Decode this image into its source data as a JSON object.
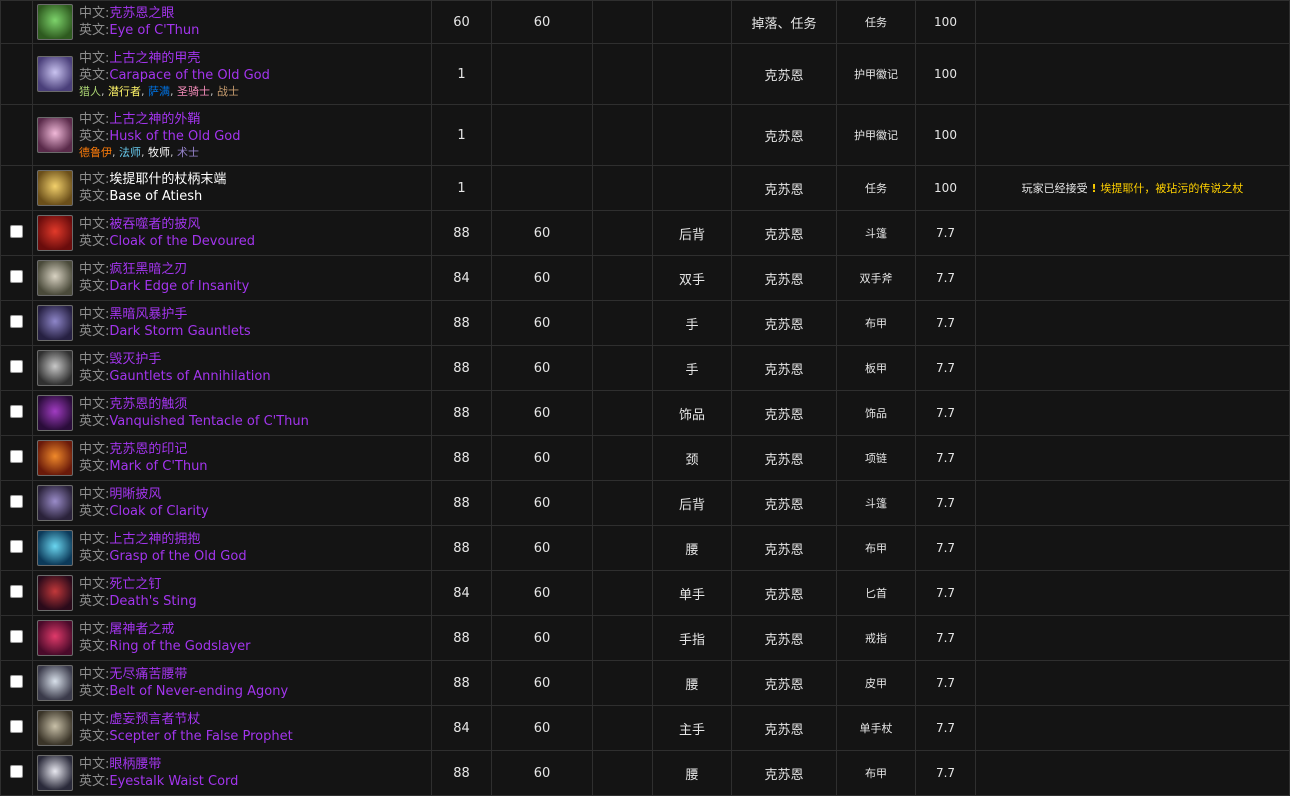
{
  "labels": {
    "cn": "中文:",
    "en": "英文:",
    "note_prefix": "玩家已经接受",
    "note_link": "埃提耶什，被玷污的传说之杖"
  },
  "rows": [
    {
      "check": false,
      "icon": "eye-of-cthun-icon",
      "icon_colors": [
        "#7dd36b",
        "#2e5a1f"
      ],
      "cn": "克苏恩之眼",
      "en": "Eye of C'Thun",
      "quality": "epic",
      "level": "60",
      "req": "60",
      "slot": "",
      "source": "掉落、任务",
      "type": "任务",
      "phase": "100",
      "classes": [],
      "note": false,
      "height": 43
    },
    {
      "check": false,
      "icon": "carapace-icon",
      "icon_colors": [
        "#c9c3f0",
        "#4a3f7a"
      ],
      "cn": "上古之神的甲壳",
      "en": "Carapace of the Old God",
      "quality": "epic",
      "level": "1",
      "req": "",
      "slot": "",
      "source": "克苏恩",
      "type": "护甲徽记",
      "phase": "100",
      "classes": [
        {
          "name": "猎人",
          "color": "#abd473"
        },
        {
          "name": "潜行者",
          "color": "#fff569"
        },
        {
          "name": "萨满",
          "color": "#0070de"
        },
        {
          "name": "圣骑士",
          "color": "#f58cba"
        },
        {
          "name": "战士",
          "color": "#c79c6e"
        }
      ],
      "note": false,
      "height": 61
    },
    {
      "check": false,
      "icon": "husk-icon",
      "icon_colors": [
        "#f0b8d8",
        "#5a2a4a"
      ],
      "cn": "上古之神的外鞘",
      "en": "Husk of the Old God",
      "quality": "epic",
      "level": "1",
      "req": "",
      "slot": "",
      "source": "克苏恩",
      "type": "护甲徽记",
      "phase": "100",
      "classes": [
        {
          "name": "德鲁伊",
          "color": "#ff7d0a"
        },
        {
          "name": "法师",
          "color": "#69ccf0"
        },
        {
          "name": "牧师",
          "color": "#ffffff"
        },
        {
          "name": "术士",
          "color": "#9482c9"
        }
      ],
      "note": false,
      "height": 61
    },
    {
      "check": false,
      "icon": "base-of-atiesh-icon",
      "icon_colors": [
        "#f2d06b",
        "#6b4f1a"
      ],
      "cn": "埃提耶什的杖柄末端",
      "en": "Base of Atiesh",
      "quality": "white",
      "level": "1",
      "req": "",
      "slot": "",
      "source": "克苏恩",
      "type": "任务",
      "phase": "100",
      "classes": [],
      "note": true,
      "height": 45
    },
    {
      "check": true,
      "icon": "cloak-devoured-icon",
      "icon_colors": [
        "#e23a2a",
        "#6a0c0c"
      ],
      "cn": "被吞噬者的披风",
      "en": "Cloak of the Devoured",
      "quality": "epic",
      "level": "88",
      "req": "60",
      "slot": "后背",
      "source": "克苏恩",
      "type": "斗篷",
      "phase": "7.7",
      "classes": [],
      "note": false,
      "height": 45
    },
    {
      "check": true,
      "icon": "dark-edge-icon",
      "icon_colors": [
        "#d8d2c2",
        "#4a4a3a"
      ],
      "cn": "疯狂黑暗之刃",
      "en": "Dark Edge of Insanity",
      "quality": "epic",
      "level": "84",
      "req": "60",
      "slot": "双手",
      "source": "克苏恩",
      "type": "双手斧",
      "phase": "7.7",
      "classes": [],
      "note": false,
      "height": 45
    },
    {
      "check": true,
      "icon": "dark-storm-gauntlets-icon",
      "icon_colors": [
        "#8e86c9",
        "#262042"
      ],
      "cn": "黑暗风暴护手",
      "en": "Dark Storm Gauntlets",
      "quality": "epic",
      "level": "88",
      "req": "60",
      "slot": "手",
      "source": "克苏恩",
      "type": "布甲",
      "phase": "7.7",
      "classes": [],
      "note": false,
      "height": 45
    },
    {
      "check": true,
      "icon": "gauntlets-annihilation-icon",
      "icon_colors": [
        "#c8c8c8",
        "#303030"
      ],
      "cn": "毁灭护手",
      "en": "Gauntlets of Annihilation",
      "quality": "epic",
      "level": "88",
      "req": "60",
      "slot": "手",
      "source": "克苏恩",
      "type": "板甲",
      "phase": "7.7",
      "classes": [],
      "note": false,
      "height": 45
    },
    {
      "check": true,
      "icon": "tentacle-icon",
      "icon_colors": [
        "#a13cc2",
        "#2a0c3a"
      ],
      "cn": "克苏恩的触须",
      "en": "Vanquished Tentacle of C'Thun",
      "quality": "epic",
      "level": "88",
      "req": "60",
      "slot": "饰品",
      "source": "克苏恩",
      "type": "饰品",
      "phase": "7.7",
      "classes": [],
      "note": false,
      "height": 45
    },
    {
      "check": true,
      "icon": "mark-of-cthun-icon",
      "icon_colors": [
        "#f0892a",
        "#6a1a0a"
      ],
      "cn": "克苏恩的印记",
      "en": "Mark of C'Thun",
      "quality": "epic",
      "level": "88",
      "req": "60",
      "slot": "颈",
      "source": "克苏恩",
      "type": "项链",
      "phase": "7.7",
      "classes": [],
      "note": false,
      "height": 45
    },
    {
      "check": true,
      "icon": "cloak-clarity-icon",
      "icon_colors": [
        "#9a8cc9",
        "#2a223a"
      ],
      "cn": "明晰披风",
      "en": "Cloak of Clarity",
      "quality": "epic",
      "level": "88",
      "req": "60",
      "slot": "后背",
      "source": "克苏恩",
      "type": "斗篷",
      "phase": "7.7",
      "classes": [],
      "note": false,
      "height": 45
    },
    {
      "check": true,
      "icon": "grasp-old-god-icon",
      "icon_colors": [
        "#6ad6f0",
        "#0c3a5a"
      ],
      "cn": "上古之神的拥抱",
      "en": "Grasp of the Old God",
      "quality": "epic",
      "level": "88",
      "req": "60",
      "slot": "腰",
      "source": "克苏恩",
      "type": "布甲",
      "phase": "7.7",
      "classes": [],
      "note": false,
      "height": 45
    },
    {
      "check": true,
      "icon": "deaths-sting-icon",
      "icon_colors": [
        "#c2383a",
        "#2a0a1a"
      ],
      "cn": "死亡之钉",
      "en": "Death's Sting",
      "quality": "epic",
      "level": "84",
      "req": "60",
      "slot": "单手",
      "source": "克苏恩",
      "type": "匕首",
      "phase": "7.7",
      "classes": [],
      "note": false,
      "height": 45
    },
    {
      "check": true,
      "icon": "ring-godslayer-icon",
      "icon_colors": [
        "#e03a6a",
        "#4a0a2a"
      ],
      "cn": "屠神者之戒",
      "en": "Ring of the Godslayer",
      "quality": "epic",
      "level": "88",
      "req": "60",
      "slot": "手指",
      "source": "克苏恩",
      "type": "戒指",
      "phase": "7.7",
      "classes": [],
      "note": false,
      "height": 45
    },
    {
      "check": true,
      "icon": "belt-agony-icon",
      "icon_colors": [
        "#d8e0ea",
        "#3a3a4a"
      ],
      "cn": "无尽痛苦腰带",
      "en": "Belt of Never-ending Agony",
      "quality": "epic",
      "level": "88",
      "req": "60",
      "slot": "腰",
      "source": "克苏恩",
      "type": "皮甲",
      "phase": "7.7",
      "classes": [],
      "note": false,
      "height": 45
    },
    {
      "check": true,
      "icon": "scepter-prophet-icon",
      "icon_colors": [
        "#c8c0a8",
        "#3a3428"
      ],
      "cn": "虚妄预言者节杖",
      "en": "Scepter of the False Prophet",
      "quality": "epic",
      "level": "84",
      "req": "60",
      "slot": "主手",
      "source": "克苏恩",
      "type": "单手杖",
      "phase": "7.7",
      "classes": [],
      "note": false,
      "height": 45
    },
    {
      "check": true,
      "icon": "eyestalk-cord-icon",
      "icon_colors": [
        "#e8e8f0",
        "#2a2a3a"
      ],
      "cn": "眼柄腰带",
      "en": "Eyestalk Waist Cord",
      "quality": "epic",
      "level": "88",
      "req": "60",
      "slot": "腰",
      "source": "克苏恩",
      "type": "布甲",
      "phase": "7.7",
      "classes": [],
      "note": false,
      "height": 45
    }
  ]
}
